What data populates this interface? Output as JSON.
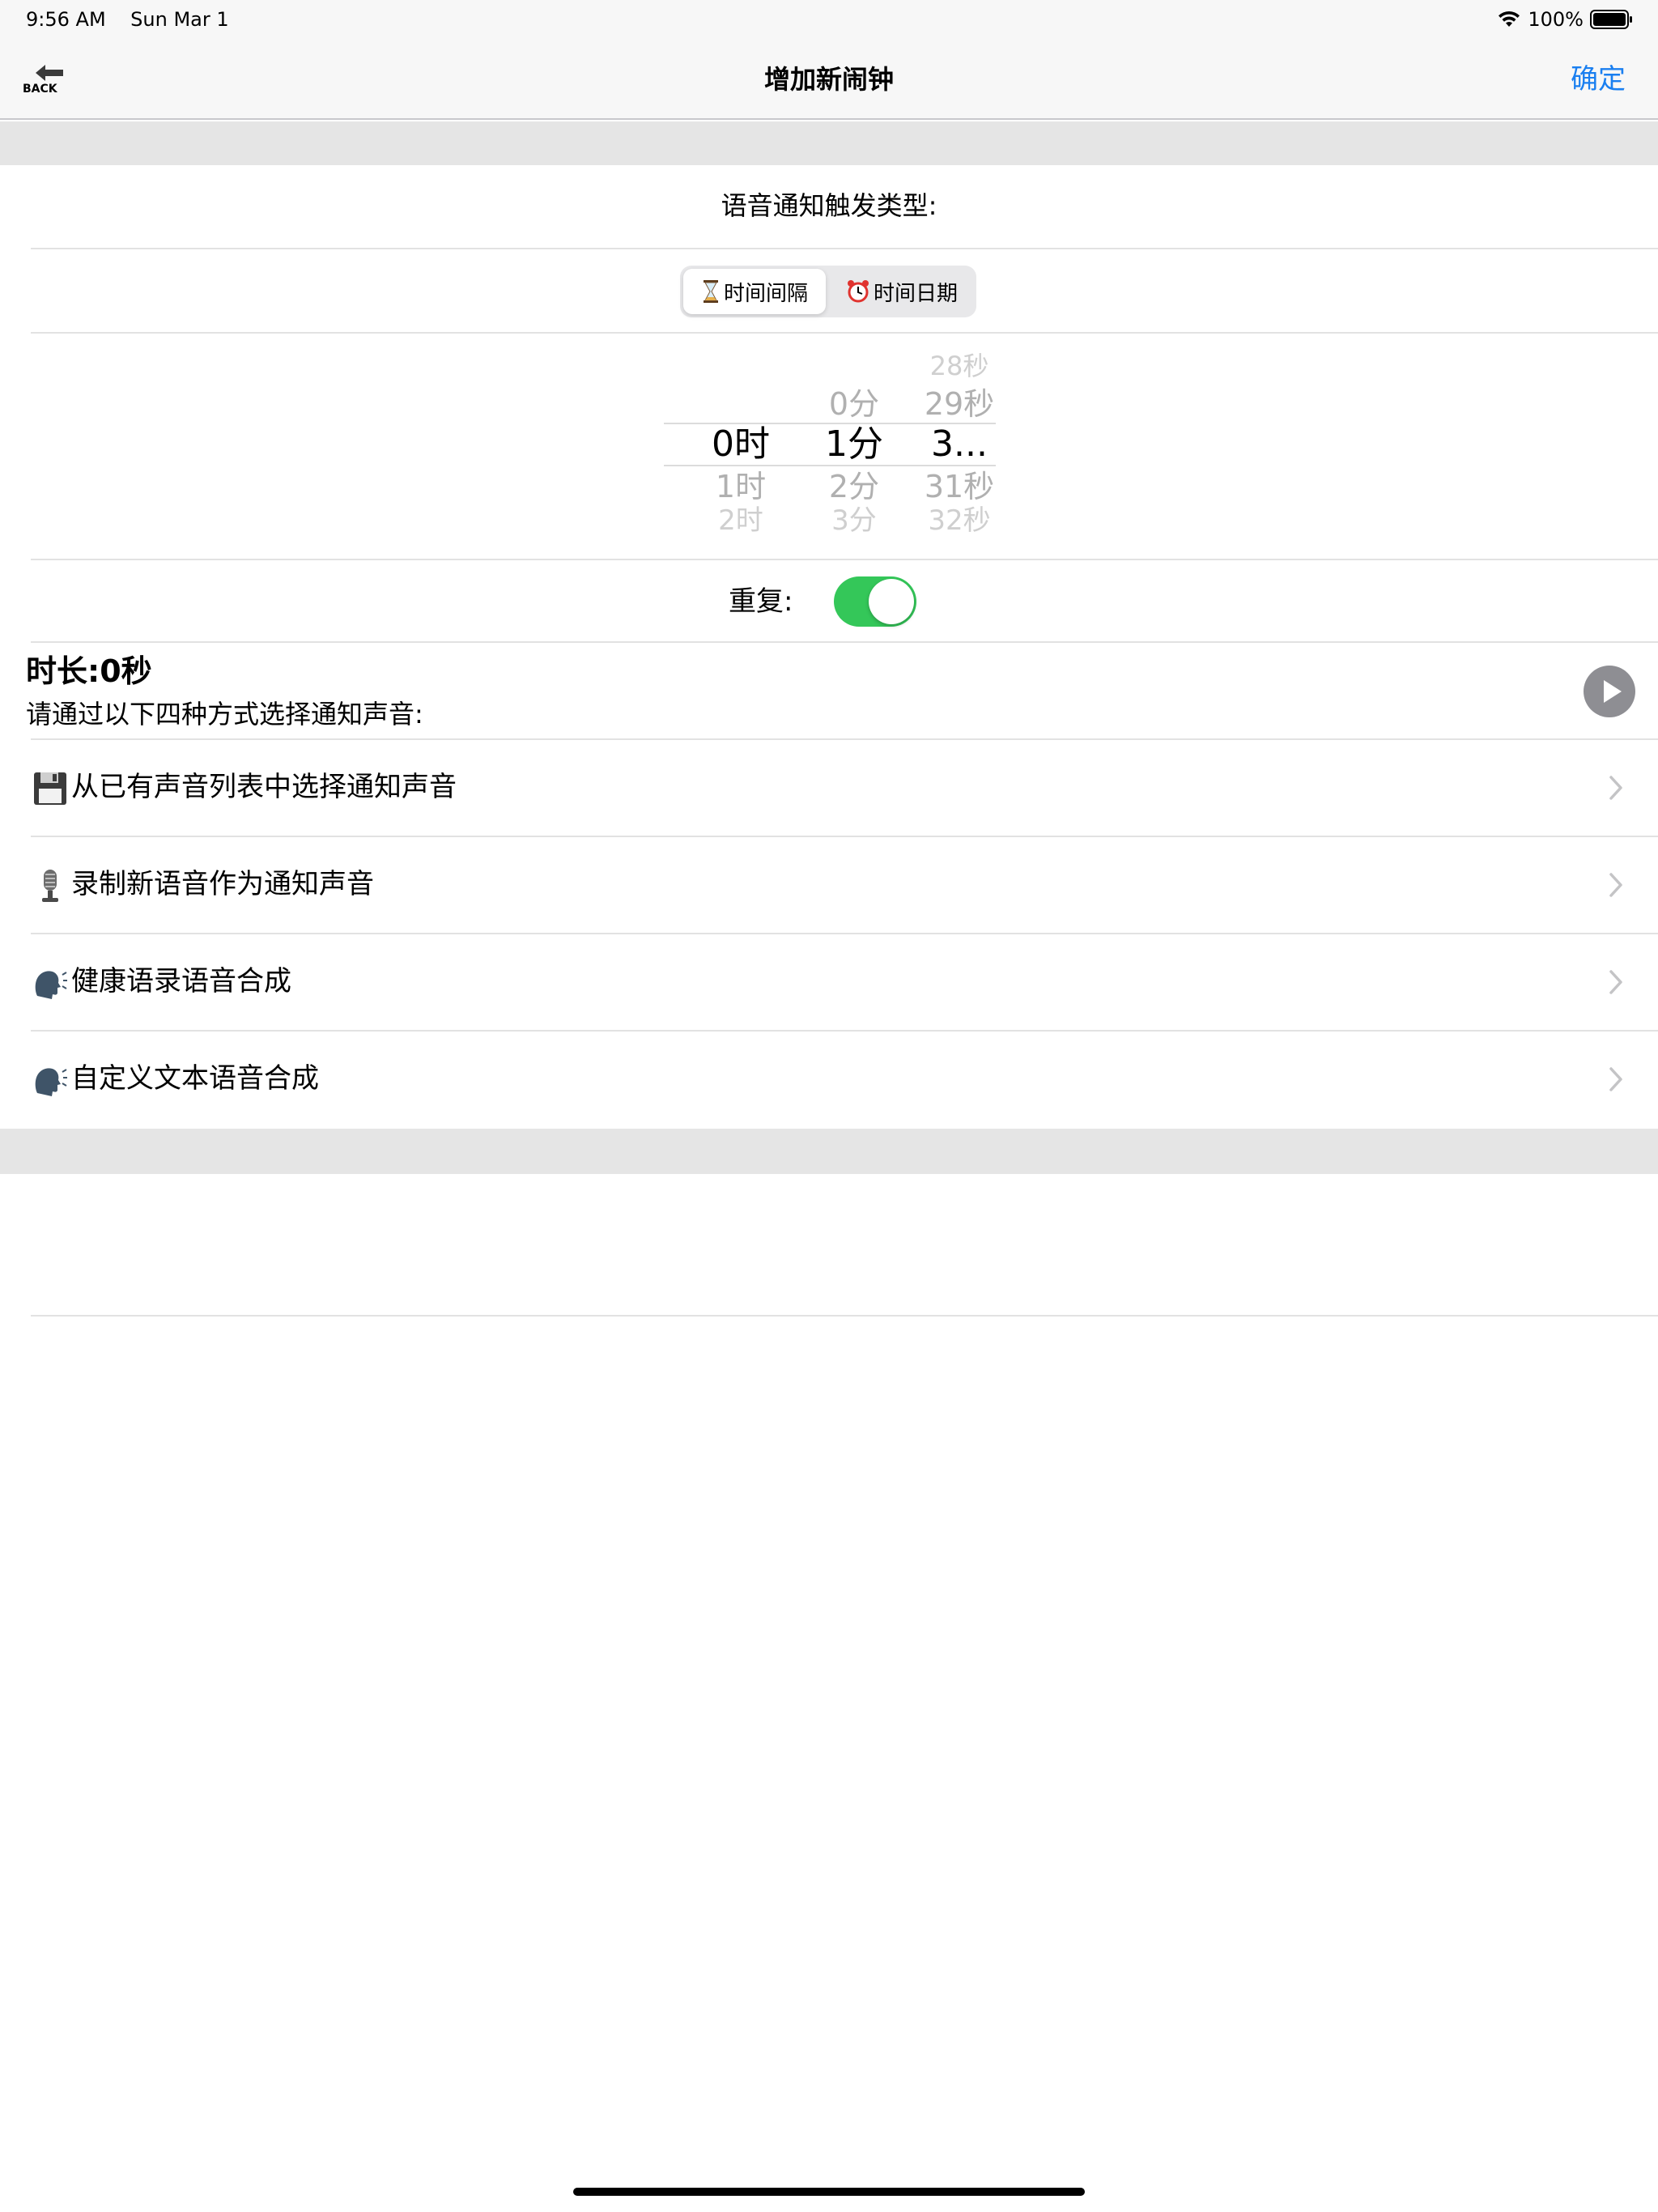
{
  "status_bar": {
    "time": "9:56 AM",
    "date": "Sun Mar 1",
    "battery": "100%"
  },
  "nav": {
    "back_label": "BACK",
    "title": "增加新闹钟",
    "confirm": "确定"
  },
  "trigger": {
    "label": "语音通知触发类型:",
    "segments": [
      {
        "icon": "hourglass-icon",
        "label": "时间间隔",
        "selected": true
      },
      {
        "icon": "alarm-clock-icon",
        "label": "时间日期",
        "selected": false
      }
    ]
  },
  "picker": {
    "hours": {
      "selected": "0时",
      "above": [],
      "below": [
        "1时",
        "2时"
      ]
    },
    "minutes": {
      "selected": "1分",
      "above": [
        "0分"
      ],
      "below": [
        "2分",
        "3分"
      ]
    },
    "seconds": {
      "selected": "3...",
      "above": [
        "28秒",
        "29秒"
      ],
      "below": [
        "31秒",
        "32秒"
      ]
    }
  },
  "repeat": {
    "label": "重复:",
    "on": true
  },
  "duration": {
    "label": "时长:0秒",
    "hint": "请通过以下四种方式选择通知声音:"
  },
  "options": [
    {
      "icon": "floppy-disk-icon",
      "label": "从已有声音列表中选择通知声音"
    },
    {
      "icon": "microphone-icon",
      "label": "录制新语音作为通知声音"
    },
    {
      "icon": "speaking-head-icon",
      "label": "健康语录语音合成"
    },
    {
      "icon": "speaking-head-icon",
      "label": "自定义文本语音合成"
    }
  ],
  "colors": {
    "accent": "#1a7ff0",
    "toggle_on": "#34c759",
    "section_bg": "#e5e5e5"
  }
}
